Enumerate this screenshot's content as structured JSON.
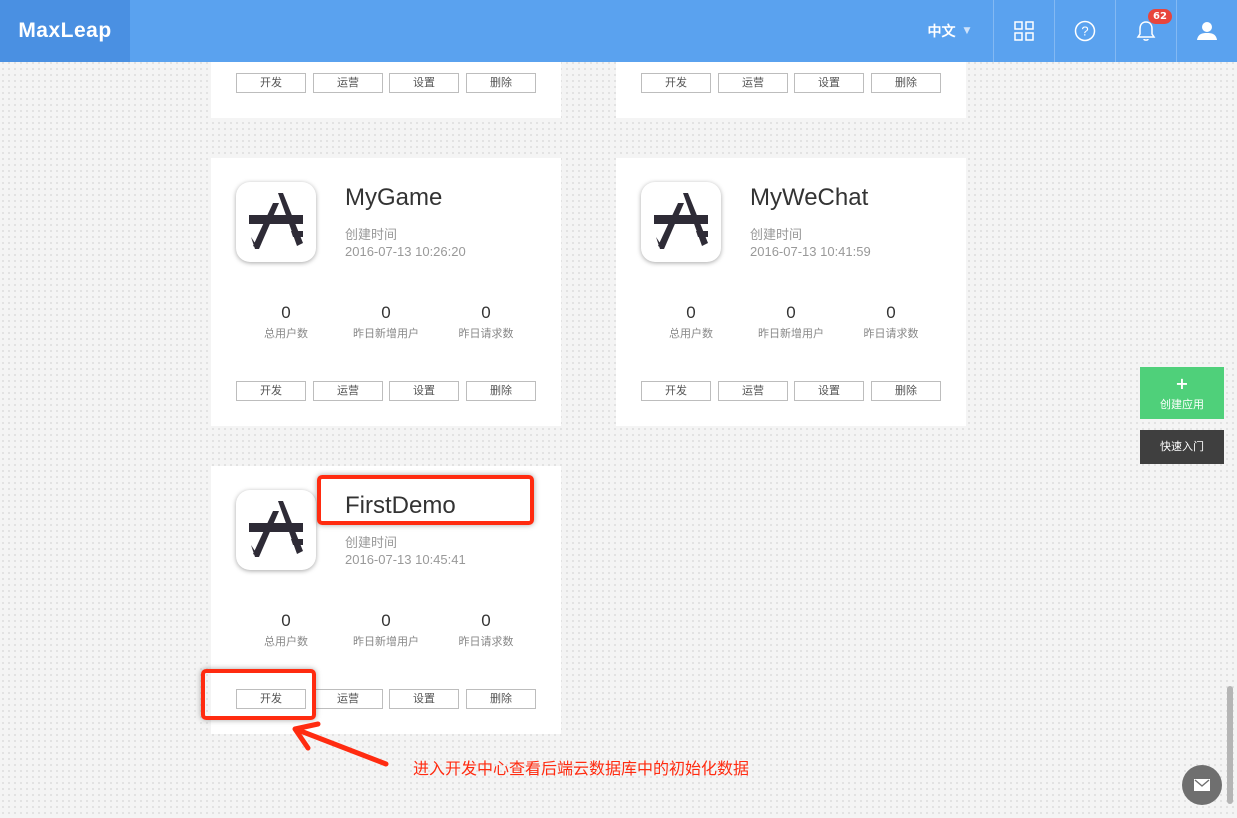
{
  "header": {
    "logo": "MaxLeap",
    "language": "中文",
    "notifications_count": "62",
    "icons": [
      "apps-grid-icon",
      "help-icon",
      "bell-icon",
      "user-icon"
    ]
  },
  "card_buttons": [
    "开发",
    "运营",
    "设置",
    "删除"
  ],
  "stat_labels": [
    "总用户数",
    "昨日新增用户",
    "昨日请求数"
  ],
  "created_label": "创建时间",
  "apps": [
    {
      "name": "MyGame",
      "created_time": "2016-07-13 10:26:20",
      "stats": [
        "0",
        "0",
        "0"
      ]
    },
    {
      "name": "MyWeChat",
      "created_time": "2016-07-13 10:41:59",
      "stats": [
        "0",
        "0",
        "0"
      ]
    },
    {
      "name": "FirstDemo",
      "created_time": "2016-07-13 10:45:41",
      "stats": [
        "0",
        "0",
        "0"
      ]
    }
  ],
  "sidebar_actions": {
    "create_app": "创建应用",
    "quick_start": "快速入门"
  },
  "annotation": {
    "note": "进入开发中心查看后端云数据库中的初始化数据"
  },
  "colors": {
    "topbar": "#5aa2ef",
    "create_app": "#4fd07a",
    "annotation": "#ff2b10"
  }
}
